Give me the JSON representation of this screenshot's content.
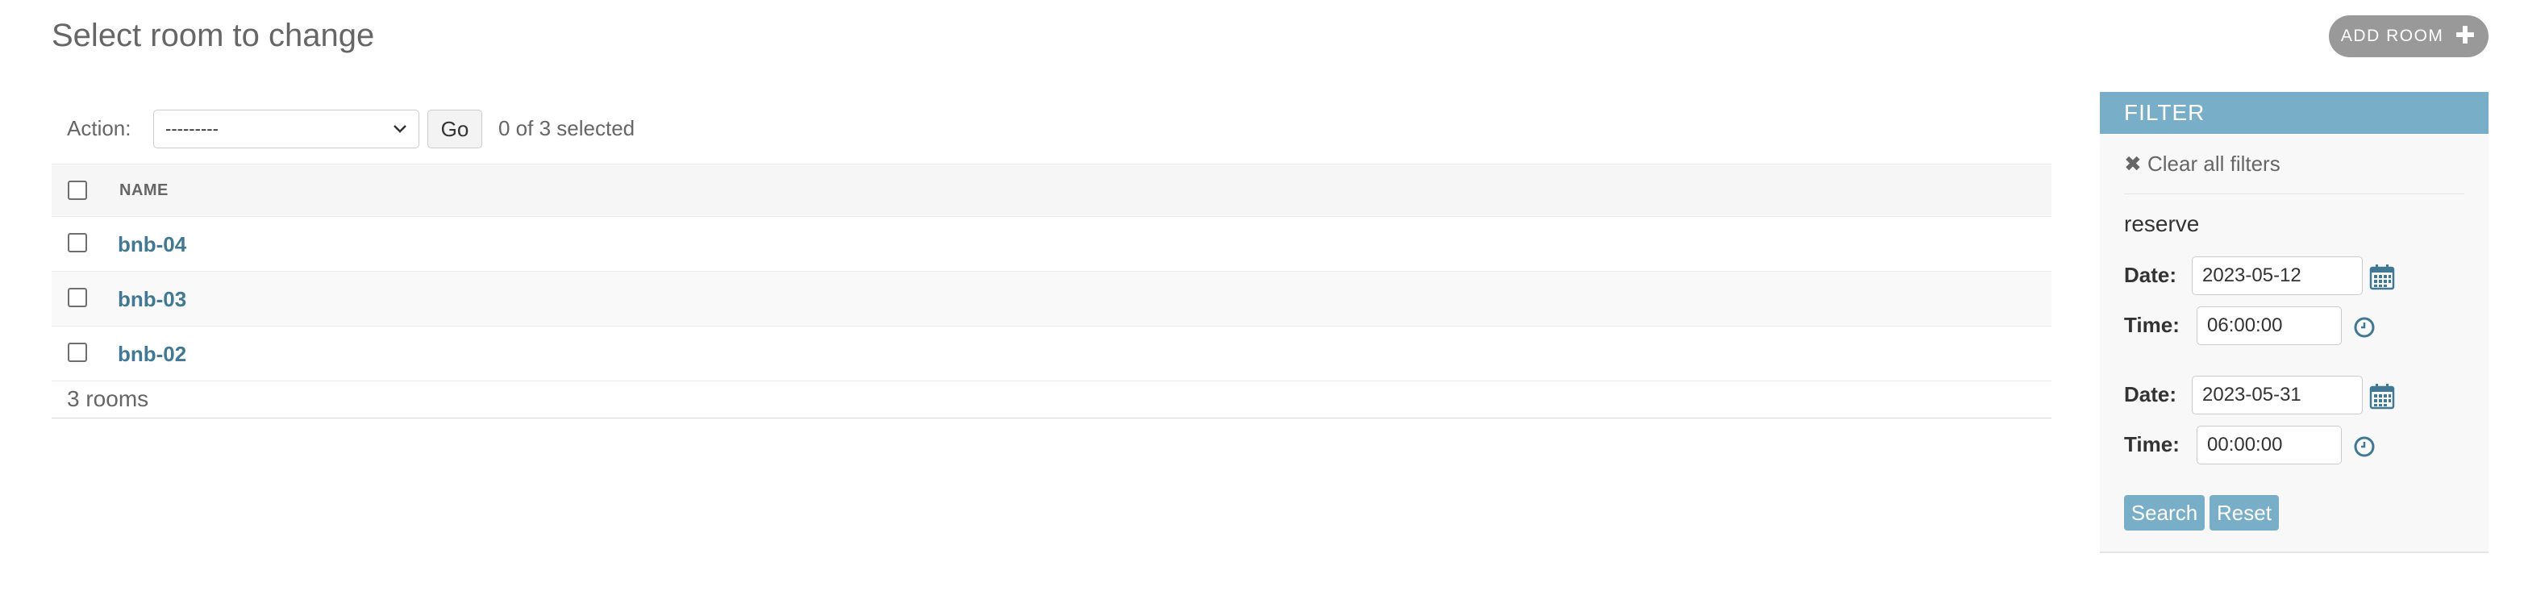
{
  "page": {
    "title": "Select room to change",
    "add_button_label": "ADD ROOM"
  },
  "actions": {
    "label": "Action:",
    "selected_option": "---------",
    "go_label": "Go",
    "selection_status": "0 of 3 selected"
  },
  "table": {
    "column_headers": [
      "NAME"
    ],
    "rows": [
      {
        "name": "bnb-04"
      },
      {
        "name": "bnb-03"
      },
      {
        "name": "bnb-02"
      }
    ],
    "footer": "3 rooms"
  },
  "filter": {
    "header": "FILTER",
    "clear_all": "✖ Clear all filters",
    "section_title": "reserve",
    "start": {
      "date_label": "Date:",
      "date_value": "2023-05-12",
      "time_label": "Time:",
      "time_value": "06:00:00"
    },
    "end": {
      "date_label": "Date:",
      "date_value": "2023-05-31",
      "time_label": "Time:",
      "time_value": "00:00:00"
    },
    "search_label": "Search",
    "reset_label": "Reset"
  },
  "colors": {
    "accent": "#79aec8",
    "link": "#417893",
    "add_button": "#999999"
  },
  "icons": [
    "plus-icon",
    "chevron-down-icon",
    "calendar-icon",
    "clock-icon",
    "close-icon"
  ]
}
